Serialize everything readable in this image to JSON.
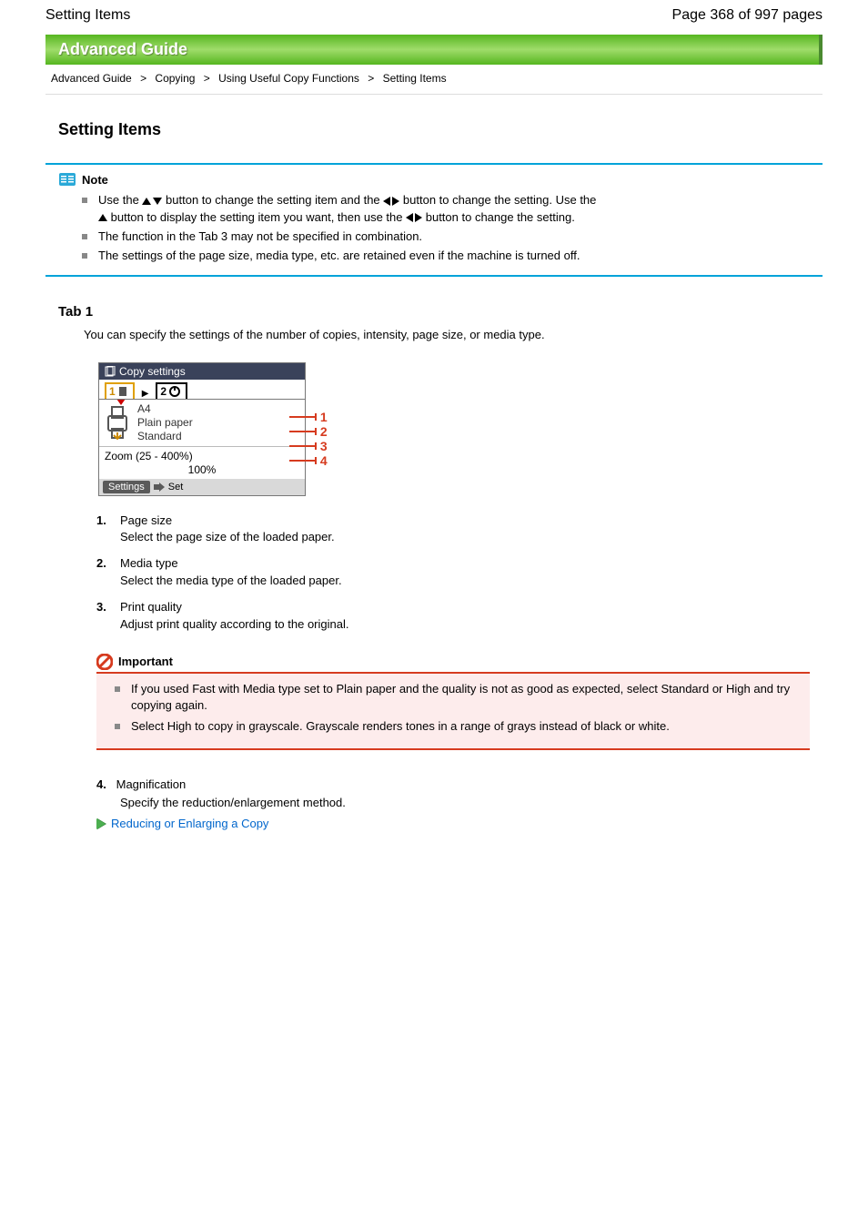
{
  "header": {
    "title": "Setting Items",
    "page_of": "Page 368 of 997 pages"
  },
  "banner": "Advanced Guide",
  "breadcrumb": [
    "Advanced Guide",
    "Copying",
    "Using Useful Copy Functions",
    "Setting Items"
  ],
  "section_title": "Setting Items",
  "note_label": "Note",
  "notes": [
    {
      "pre": "Use the ",
      "mid": " button to change the setting item and the ",
      "post": " button to change the setting. Use the"
    },
    " button to display the setting item you want, then use the ",
    " button to change the setting.",
    "The function in the Tab 3 may not be specified in combination.",
    "The settings of the page size, media type, etc. are retained even if the machine is turned off."
  ],
  "tab1": {
    "title": "Tab 1",
    "desc": "You can specify the settings of the number of copies, intensity, page size, or media type.",
    "copy_settings_label": "Copy settings",
    "tab_a": "1",
    "tab_b": "2",
    "paper_size": "A4",
    "paper_type": "Plain paper",
    "quality": "Standard",
    "zoom_label": "Zoom (25 - 400%)",
    "zoom_value": "100%",
    "footer_settings": "Settings",
    "footer_set": "Set"
  },
  "legend": [
    {
      "num": "1.",
      "text": "Page size",
      "sub": "Select the page size of the loaded paper."
    },
    {
      "num": "2.",
      "text": "Media type",
      "sub": "Select the media type of the loaded paper."
    },
    {
      "num": "3.",
      "text": "Print quality",
      "sub": "Adjust print quality according to the original."
    }
  ],
  "important_label": "Important",
  "important": [
    "If you used Fast with Media type set to Plain paper and the quality is not as good as expected, select Standard or High and try copying again.",
    "Select High to copy in grayscale. Grayscale renders tones in a range of grays instead of black or white."
  ],
  "magnify": {
    "num": "4.",
    "label": "Magnification",
    "sub": "Specify the reduction/enlargement method.",
    "link": "Reducing or Enlarging a Copy"
  }
}
